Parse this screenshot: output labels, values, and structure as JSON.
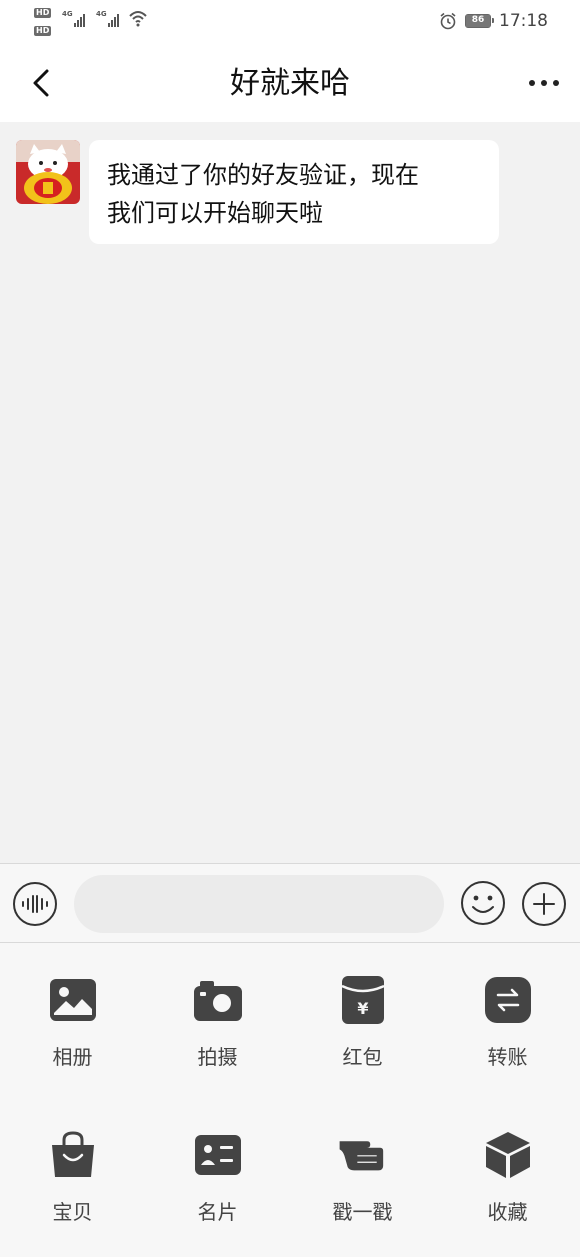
{
  "status_bar": {
    "time": "17:18",
    "battery": "86",
    "sim1": "HD",
    "sim2": "HD",
    "net1": "4G",
    "net2": "4G"
  },
  "header": {
    "title": "好就来哈"
  },
  "messages": [
    {
      "side": "left",
      "text_line1": "我通过了你的好友验证，现在",
      "text_line2": "我们可以开始聊天啦"
    }
  ],
  "input": {
    "value": "",
    "placeholder": ""
  },
  "panel": {
    "items": [
      {
        "label": "相册",
        "icon": "album-icon"
      },
      {
        "label": "拍摄",
        "icon": "camera-icon"
      },
      {
        "label": "红包",
        "icon": "red-packet-icon"
      },
      {
        "label": "转账",
        "icon": "transfer-icon"
      },
      {
        "label": "宝贝",
        "icon": "shopping-bag-icon"
      },
      {
        "label": "名片",
        "icon": "business-card-icon"
      },
      {
        "label": "戳一戳",
        "icon": "poke-hand-icon"
      },
      {
        "label": "收藏",
        "icon": "favorites-box-icon"
      }
    ]
  },
  "colors": {
    "chat_bg": "#f2f2f2",
    "bubble_bg": "#ffffff",
    "icon_dark": "#444444"
  }
}
